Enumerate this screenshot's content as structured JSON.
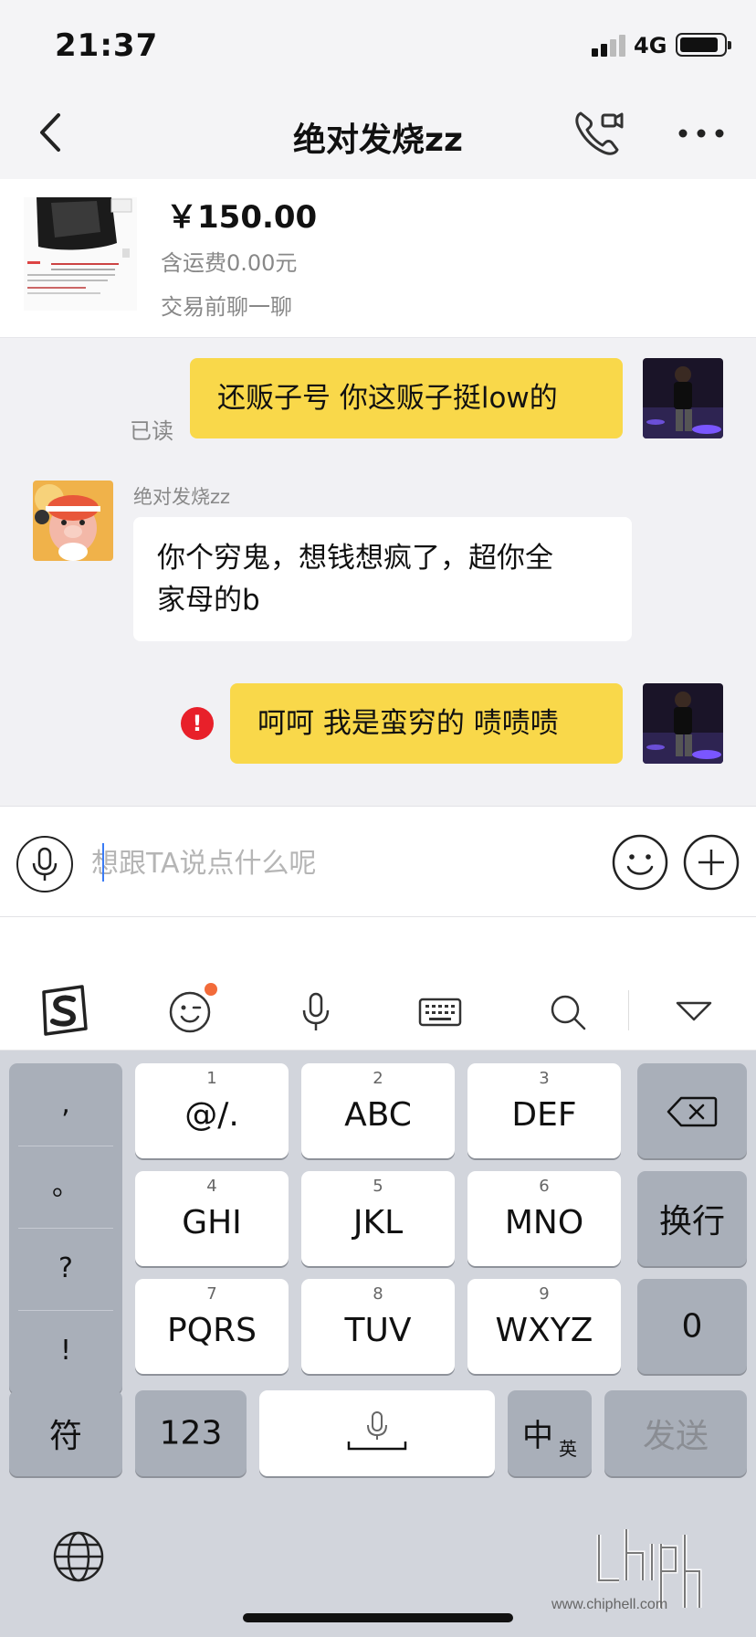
{
  "status_bar": {
    "time": "21:37",
    "network": "4G",
    "battery_level": 0.9
  },
  "nav": {
    "title": "绝对发烧zz",
    "back_icon": "chevron-left-icon",
    "call_icon": "phone-video-icon",
    "more_icon": "more-icon"
  },
  "product": {
    "price": "￥150.00",
    "shipping": "含运费0.00元",
    "chat_hint": "交易前聊一聊"
  },
  "messages": {
    "m1": {
      "text": "还贩子号 你这贩子挺low的",
      "read_status": "已读"
    },
    "m2": {
      "sender": "绝对发烧zz",
      "text_line1": "你个穷鬼，想钱想疯了，超你全",
      "text_line2": "家母的b"
    },
    "m3": {
      "text": "呵呵 我是蛮穷的 啧啧啧",
      "error_mark": "!"
    }
  },
  "input": {
    "placeholder": "想跟TA说点什么呢"
  },
  "ime_toolbar": {
    "icons": [
      "sogou-logo-icon",
      "emoji-wink-icon",
      "mic-icon",
      "keyboard-icon",
      "search-icon",
      "collapse-icon"
    ]
  },
  "keyboard": {
    "punct": [
      ",",
      "。",
      "?",
      "!"
    ],
    "keys": {
      "k1": {
        "num": "1",
        "label": "@/."
      },
      "k2": {
        "num": "2",
        "label": "ABC"
      },
      "k3": {
        "num": "3",
        "label": "DEF"
      },
      "k4": {
        "num": "4",
        "label": "GHI"
      },
      "k5": {
        "num": "5",
        "label": "JKL"
      },
      "k6": {
        "num": "6",
        "label": "MNO"
      },
      "k7": {
        "num": "7",
        "label": "PQRS"
      },
      "k8": {
        "num": "8",
        "label": "TUV"
      },
      "k9": {
        "num": "9",
        "label": "WXYZ"
      },
      "k0": {
        "label": "0"
      }
    },
    "newline": "换行",
    "symbols": "符",
    "numbers": "123",
    "lang_zh": "中",
    "lang_en": "英",
    "send": "发送"
  },
  "watermark": {
    "text": "www.chiphell.com"
  }
}
